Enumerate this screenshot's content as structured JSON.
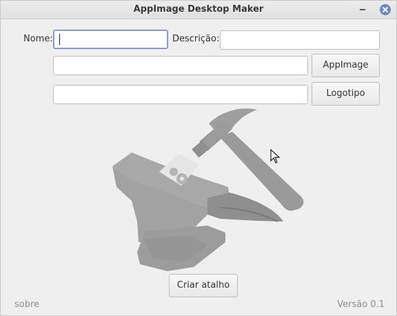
{
  "window": {
    "title": "AppImage Desktop Maker"
  },
  "form": {
    "name_label": "Nome:",
    "name_value": "",
    "description_label": "Descrição:",
    "description_value": "",
    "appimage_path_value": "",
    "appimage_button": "AppImage",
    "logo_path_value": "",
    "logo_button": "Logotipo"
  },
  "actions": {
    "create_shortcut_button": "Criar atalho"
  },
  "footer": {
    "about_link": "sobre",
    "version": "Versão 0.1"
  },
  "colors": {
    "focus_border": "#6a86c6",
    "close_button": "#6d87c6",
    "illustration_gray": "#a9a9a9"
  },
  "icons": {
    "title_minimize": "minimize-icon",
    "title_close": "close-icon",
    "illustration": "anvil-hammer-icon",
    "pointer": "mouse-cursor-icon"
  }
}
